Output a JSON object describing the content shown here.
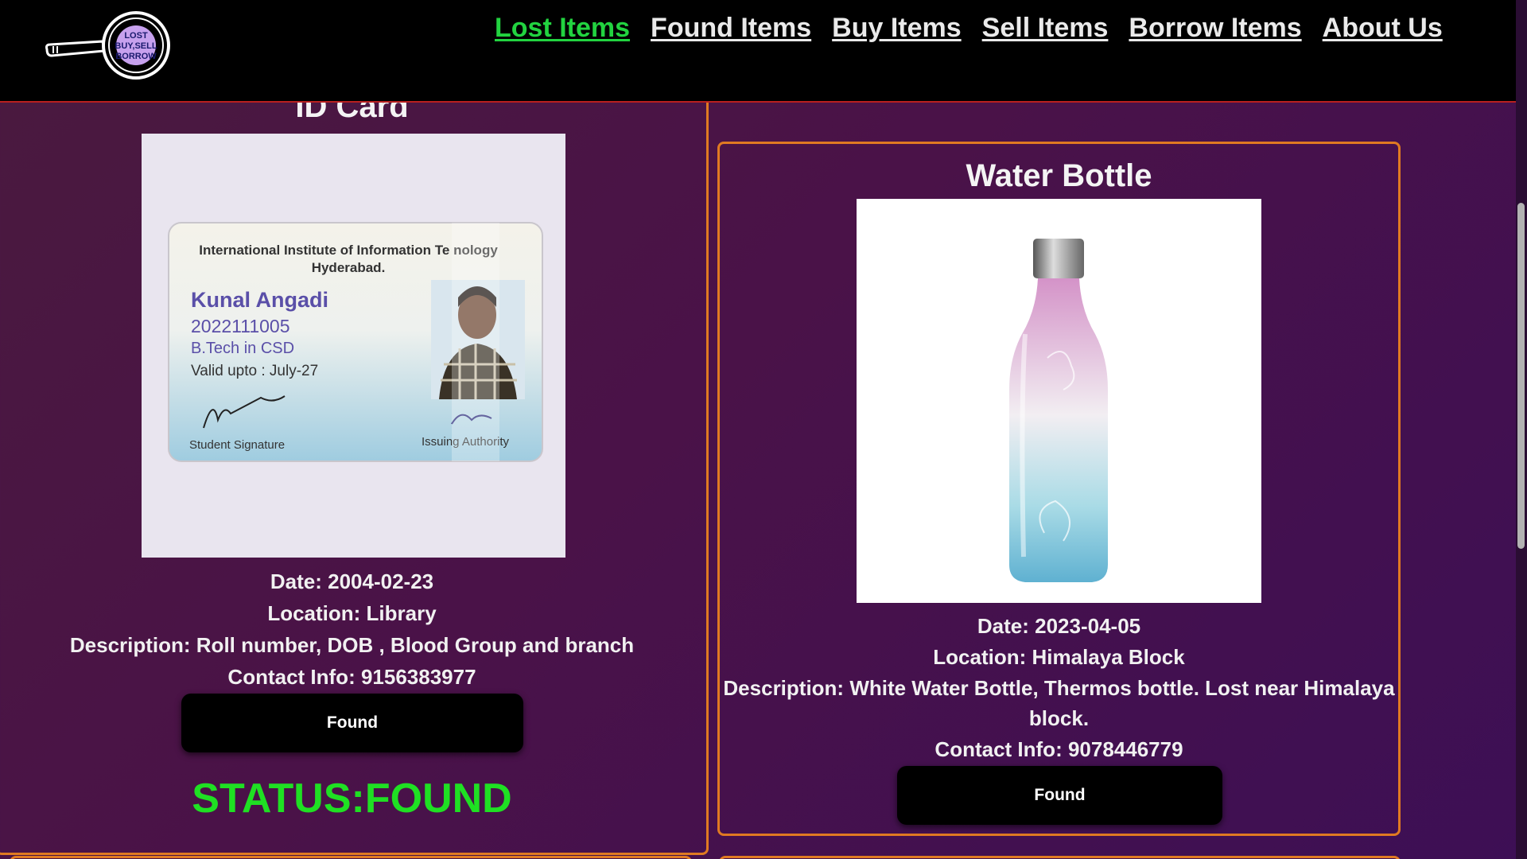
{
  "nav": {
    "logo_text": [
      "LOST",
      "BUY,SELL",
      "BORROW"
    ],
    "links": [
      {
        "label": "Lost Items",
        "active": true
      },
      {
        "label": "Found Items",
        "active": false
      },
      {
        "label": "Buy Items",
        "active": false
      },
      {
        "label": "Sell Items",
        "active": false
      },
      {
        "label": "Borrow Items",
        "active": false
      },
      {
        "label": "About Us",
        "active": false
      }
    ]
  },
  "cards": [
    {
      "title": "ID Card",
      "id_card": {
        "institute_line1": "International Institute of Information Te  nology",
        "institute_line2": "Hyderabad.",
        "name": "Kunal Angadi",
        "roll": "2022111005",
        "program": "B.Tech in CSD",
        "valid": "Valid upto : July-27",
        "student_sig": "Student Signature",
        "issuing": "Issuing Authority"
      },
      "date": "Date: 2004-02-23",
      "location": "Location: Library",
      "description": "Description: Roll number, DOB , Blood Group and branch",
      "contact": "Contact Info: 9156383977",
      "button": "Found",
      "status": "STATUS:FOUND"
    },
    {
      "title": "Water Bottle",
      "date": "Date: 2023-04-05",
      "location": "Location: Himalaya Block",
      "description_line1": "Description: White Water Bottle, Thermos bottle. Lost near Himalaya",
      "description_line2": "block.",
      "contact": "Contact Info: 9078446779",
      "button": "Found"
    }
  ],
  "colors": {
    "accent_green": "#22d340",
    "border_orange": "#e07a22",
    "status_green": "#1fe023"
  }
}
